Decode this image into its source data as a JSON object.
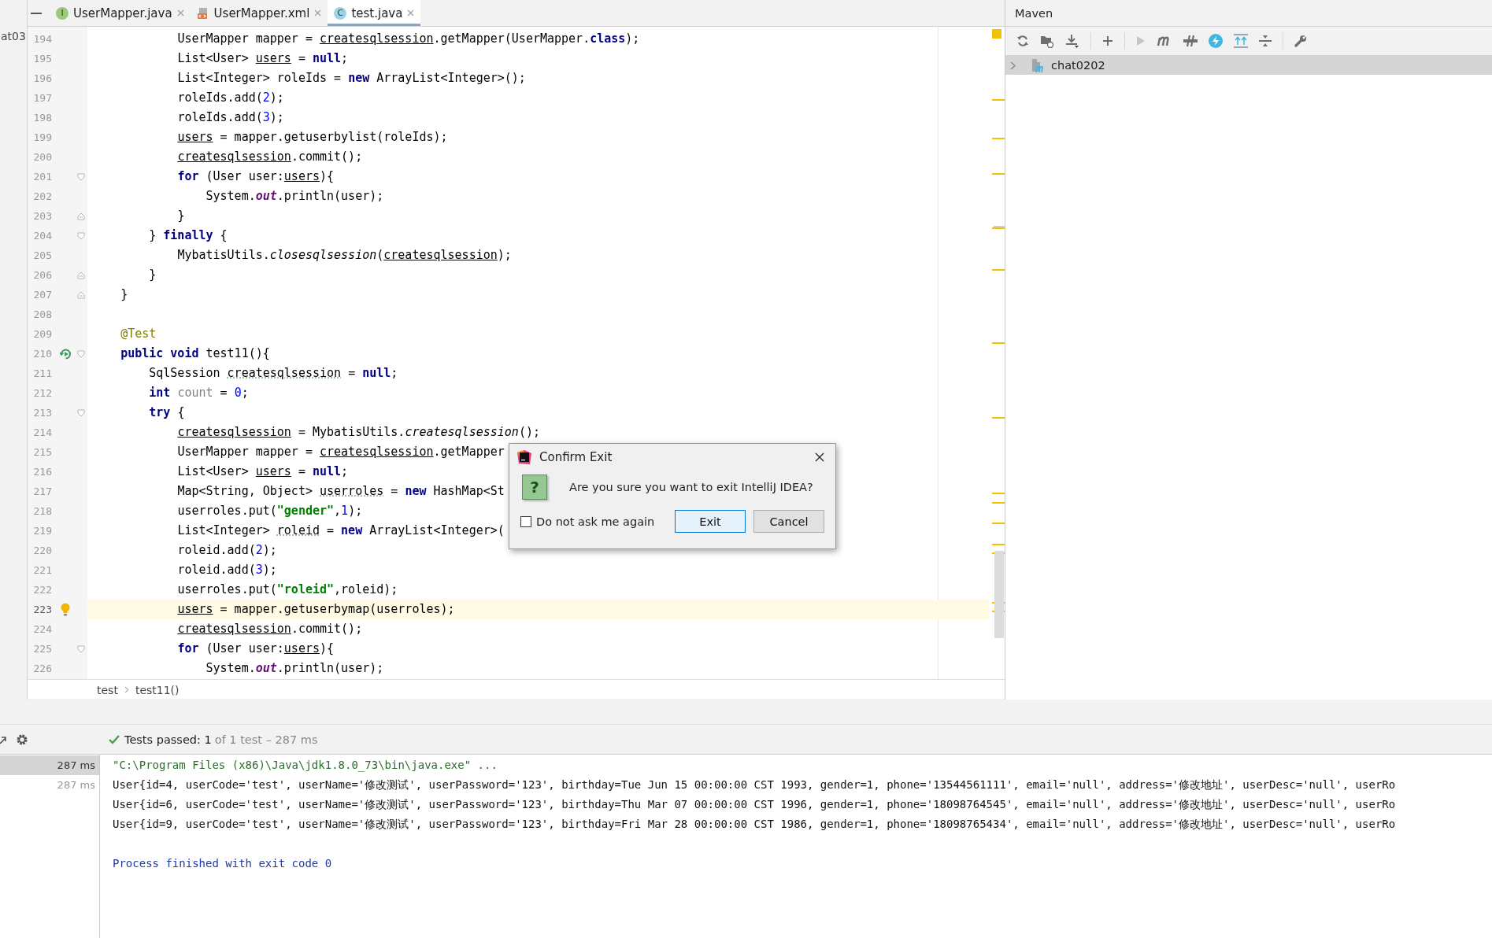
{
  "tabs": [
    {
      "label": "UserMapper.java",
      "kind": "interface",
      "icon_letter": "I",
      "selected": false
    },
    {
      "label": "UserMapper.xml",
      "kind": "xml",
      "selected": false
    },
    {
      "label": "test.java",
      "kind": "class",
      "icon_letter": "C",
      "selected": true
    }
  ],
  "project_panel": {
    "fragment": "at03"
  },
  "editor": {
    "lines": [
      {
        "number": "194",
        "current": false,
        "code": [
          {
            "text": "            UserMapper mapper = ",
            "kind": "plain"
          },
          {
            "text": "createsqlsession",
            "kind": "var"
          },
          {
            "text": ".getMapper(UserMapper.",
            "kind": "plain"
          },
          {
            "text": "class",
            "kind": "keyword"
          },
          {
            "text": ");",
            "kind": "plain"
          }
        ]
      },
      {
        "number": "195",
        "current": false,
        "code": [
          {
            "text": "            List<User> ",
            "kind": "plain"
          },
          {
            "text": "users",
            "kind": "var"
          },
          {
            "text": " = ",
            "kind": "plain"
          },
          {
            "text": "null",
            "kind": "keyword"
          },
          {
            "text": ";",
            "kind": "plain"
          }
        ]
      },
      {
        "number": "196",
        "current": false,
        "code": [
          {
            "text": "            List<Integer> roleIds = ",
            "kind": "plain"
          },
          {
            "text": "new",
            "kind": "keyword"
          },
          {
            "text": " ArrayList<Integer>();",
            "kind": "plain"
          }
        ]
      },
      {
        "number": "197",
        "current": false,
        "code": [
          {
            "text": "            roleIds.add(",
            "kind": "plain"
          },
          {
            "text": "2",
            "kind": "number"
          },
          {
            "text": ");",
            "kind": "plain"
          }
        ]
      },
      {
        "number": "198",
        "current": false,
        "code": [
          {
            "text": "            roleIds.add(",
            "kind": "plain"
          },
          {
            "text": "3",
            "kind": "number"
          },
          {
            "text": ");",
            "kind": "plain"
          }
        ]
      },
      {
        "number": "199",
        "current": false,
        "code": [
          {
            "text": "            users",
            "kind": "var"
          },
          {
            "text": " = mapper.getuserbylist(roleIds);",
            "kind": "plain"
          }
        ]
      },
      {
        "number": "200",
        "current": false,
        "code": [
          {
            "text": "            createsqlsession",
            "kind": "var"
          },
          {
            "text": ".commit();",
            "kind": "plain"
          }
        ]
      },
      {
        "number": "201",
        "current": false,
        "fold": {
          "kind": "open"
        },
        "code": [
          {
            "text": "            for",
            "kind": "keyword"
          },
          {
            "text": " (User user:",
            "kind": "plain"
          },
          {
            "text": "users",
            "kind": "var"
          },
          {
            "text": "){",
            "kind": "plain"
          }
        ]
      },
      {
        "number": "202",
        "current": false,
        "code": [
          {
            "text": "                System.",
            "kind": "plain"
          },
          {
            "text": "out",
            "kind": "field"
          },
          {
            "text": ".println(user);",
            "kind": "plain"
          }
        ]
      },
      {
        "number": "203",
        "current": false,
        "fold": {
          "kind": "close"
        },
        "code": [
          {
            "text": "            }",
            "kind": "plain"
          }
        ]
      },
      {
        "number": "204",
        "current": false,
        "fold": {
          "kind": "open"
        },
        "code": [
          {
            "text": "        } ",
            "kind": "plain"
          },
          {
            "text": "finally",
            "kind": "keyword"
          },
          {
            "text": " {",
            "kind": "plain"
          }
        ]
      },
      {
        "number": "205",
        "current": false,
        "code": [
          {
            "text": "            MybatisUtils.",
            "kind": "plain"
          },
          {
            "text": "closesqlsession",
            "kind": "static"
          },
          {
            "text": "(",
            "kind": "plain"
          },
          {
            "text": "createsqlsession",
            "kind": "var"
          },
          {
            "text": ");",
            "kind": "plain"
          }
        ]
      },
      {
        "number": "206",
        "current": false,
        "fold": {
          "kind": "close"
        },
        "code": [
          {
            "text": "        }",
            "kind": "plain"
          }
        ]
      },
      {
        "number": "207",
        "current": false,
        "fold": {
          "kind": "close"
        },
        "code": [
          {
            "text": "    }",
            "kind": "plain"
          }
        ]
      },
      {
        "number": "208",
        "current": false
      },
      {
        "number": "209",
        "current": false,
        "code": [
          {
            "text": "    @Test",
            "kind": "annotation"
          }
        ]
      },
      {
        "number": "210",
        "current": false,
        "fold": {
          "kind": "open"
        },
        "gutter_icon": {
          "kind": "run"
        },
        "code": [
          {
            "text": "    public void",
            "kind": "keyword"
          },
          {
            "text": " test11(){",
            "kind": "plain"
          }
        ]
      },
      {
        "number": "211",
        "current": false,
        "code": [
          {
            "text": "        SqlSession ",
            "kind": "plain"
          },
          {
            "text": "createsqlsession",
            "kind": "warn"
          },
          {
            "text": " = ",
            "kind": "plain"
          },
          {
            "text": "null",
            "kind": "keyword"
          },
          {
            "text": ";",
            "kind": "plain"
          }
        ]
      },
      {
        "number": "212",
        "current": false,
        "code": [
          {
            "text": "        int",
            "kind": "keyword"
          },
          {
            "text": " count",
            "kind": "unused"
          },
          {
            "text": " = ",
            "kind": "plain"
          },
          {
            "text": "0",
            "kind": "number"
          },
          {
            "text": ";",
            "kind": "plain"
          }
        ]
      },
      {
        "number": "213",
        "current": false,
        "fold": {
          "kind": "open"
        },
        "code": [
          {
            "text": "        try",
            "kind": "keyword"
          },
          {
            "text": " {",
            "kind": "plain"
          }
        ]
      },
      {
        "number": "214",
        "current": false,
        "code": [
          {
            "text": "            createsqlsession",
            "kind": "var"
          },
          {
            "text": " = MybatisUtils.",
            "kind": "plain"
          },
          {
            "text": "createsqlsession",
            "kind": "static"
          },
          {
            "text": "();",
            "kind": "plain"
          }
        ]
      },
      {
        "number": "215",
        "current": false,
        "code": [
          {
            "text": "            UserMapper mapper = ",
            "kind": "plain"
          },
          {
            "text": "createsqlsession",
            "kind": "var"
          },
          {
            "text": ".getMapper",
            "kind": "plain"
          }
        ]
      },
      {
        "number": "216",
        "current": false,
        "code": [
          {
            "text": "            List<User> ",
            "kind": "plain"
          },
          {
            "text": "users",
            "kind": "var"
          },
          {
            "text": " = ",
            "kind": "plain"
          },
          {
            "text": "null",
            "kind": "keyword"
          },
          {
            "text": ";",
            "kind": "plain"
          }
        ]
      },
      {
        "number": "217",
        "current": false,
        "code": [
          {
            "text": "            Map<String, Object> ",
            "kind": "plain"
          },
          {
            "text": "userroles",
            "kind": "warn"
          },
          {
            "text": " = ",
            "kind": "plain"
          },
          {
            "text": "new",
            "kind": "keyword"
          },
          {
            "text": " HashMap<St",
            "kind": "plain"
          }
        ]
      },
      {
        "number": "218",
        "current": false,
        "code": [
          {
            "text": "            userroles.put(",
            "kind": "plain"
          },
          {
            "text": "\"gender\"",
            "kind": "string"
          },
          {
            "text": ",",
            "kind": "plain"
          },
          {
            "text": "1",
            "kind": "number"
          },
          {
            "text": ");",
            "kind": "plain"
          }
        ]
      },
      {
        "number": "219",
        "current": false,
        "code": [
          {
            "text": "            List<Integer> ",
            "kind": "plain"
          },
          {
            "text": "roleid",
            "kind": "warn"
          },
          {
            "text": " = ",
            "kind": "plain"
          },
          {
            "text": "new",
            "kind": "keyword"
          },
          {
            "text": " ArrayList<Integer>(",
            "kind": "plain"
          }
        ]
      },
      {
        "number": "220",
        "current": false,
        "code": [
          {
            "text": "            roleid.add(",
            "kind": "plain"
          },
          {
            "text": "2",
            "kind": "number"
          },
          {
            "text": ");",
            "kind": "plain"
          }
        ]
      },
      {
        "number": "221",
        "current": false,
        "code": [
          {
            "text": "            roleid.add(",
            "kind": "plain"
          },
          {
            "text": "3",
            "kind": "number"
          },
          {
            "text": ");",
            "kind": "plain"
          }
        ]
      },
      {
        "number": "222",
        "current": false,
        "code": [
          {
            "text": "            userroles.put(",
            "kind": "plain"
          },
          {
            "text": "\"roleid\"",
            "kind": "string"
          },
          {
            "text": ",roleid);",
            "kind": "plain"
          }
        ]
      },
      {
        "number": "223",
        "current": true,
        "gutter_icon": {
          "kind": "bulb"
        },
        "code": [
          {
            "text": "            users",
            "kind": "var"
          },
          {
            "text": " = mapper.getuserbymap(userroles);",
            "kind": "plain"
          }
        ]
      },
      {
        "number": "224",
        "current": false,
        "code": [
          {
            "text": "            createsqlsession",
            "kind": "var"
          },
          {
            "text": ".commit();",
            "kind": "plain"
          }
        ]
      },
      {
        "number": "225",
        "current": false,
        "fold": {
          "kind": "open"
        },
        "code": [
          {
            "text": "            for",
            "kind": "keyword"
          },
          {
            "text": " (User user:",
            "kind": "plain"
          },
          {
            "text": "users",
            "kind": "var"
          },
          {
            "text": "){",
            "kind": "plain"
          }
        ]
      },
      {
        "number": "226",
        "current": false,
        "code": [
          {
            "text": "                System.",
            "kind": "plain"
          },
          {
            "text": "out",
            "kind": "field"
          },
          {
            "text": ".println(user);",
            "kind": "plain"
          }
        ]
      }
    ]
  },
  "breadcrumb": [
    "test",
    "test11()"
  ],
  "dialog": {
    "title": "Confirm Exit",
    "icon_char": "?",
    "message": "Are you sure you want to exit IntelliJ IDEA?",
    "checkbox": {
      "label": "Do not ask me again",
      "checked": false
    },
    "buttons": [
      {
        "label": "Exit",
        "default": true
      },
      {
        "label": "Cancel",
        "default": false
      }
    ]
  },
  "maven": {
    "title": "Maven",
    "tree": [
      {
        "label": "chat0202",
        "expanded": false,
        "selected": true
      }
    ]
  },
  "tests": {
    "status": "Tests passed: 1",
    "detail": "of 1 test – 287 ms"
  },
  "run_tree": [
    {
      "label": "287 ms",
      "selected": true
    },
    {
      "label": "287 ms",
      "selected": false
    }
  ],
  "console": [
    {
      "kind": "command",
      "text": "\"C:\\Program Files (x86)\\Java\\jdk1.8.0_73\\bin\\java.exe\" ..."
    },
    {
      "kind": "output",
      "text": "User{id=4, userCode='test', userName='修改测试', userPassword='123', birthday=Tue Jun 15 00:00:00 CST 1993, gender=1, phone='13544561111', email='null', address='修改地址', userDesc='null', userRo"
    },
    {
      "kind": "output",
      "text": "User{id=6, userCode='test', userName='修改测试', userPassword='123', birthday=Thu Mar 07 00:00:00 CST 1996, gender=1, phone='18098764545', email='null', address='修改地址', userDesc='null', userRo"
    },
    {
      "kind": "output",
      "text": "User{id=9, userCode='test', userName='修改测试', userPassword='123', birthday=Fri Mar 28 00:00:00 CST 1986, gender=1, phone='18098765434', email='null', address='修改地址', userDesc='null', userRo"
    },
    {
      "kind": "exit",
      "text": "Process finished with exit code 0"
    }
  ]
}
